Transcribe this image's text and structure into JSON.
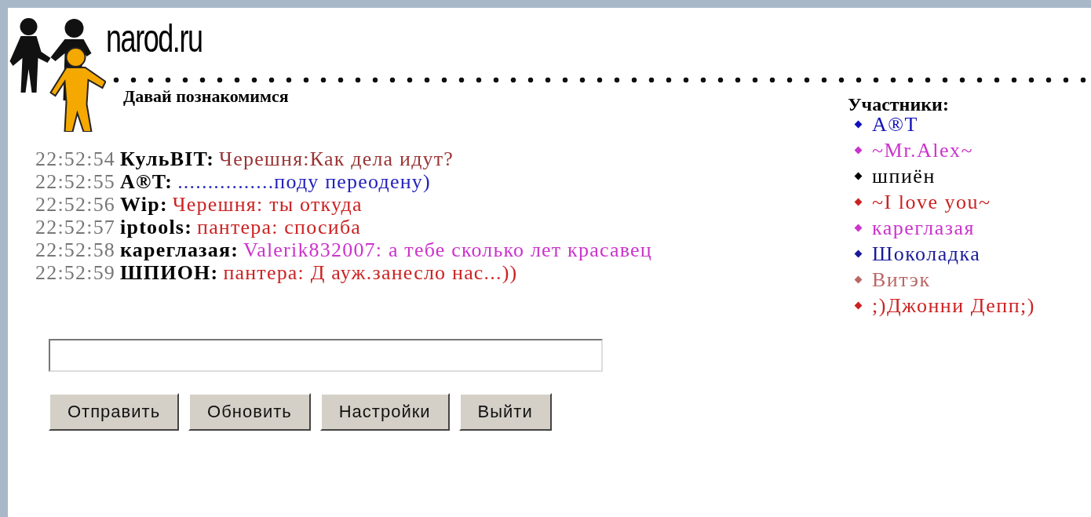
{
  "brand": "narod.ru",
  "room_title": "Давай познакомимся",
  "messages": [
    {
      "time": "22:52:54",
      "author": "КульBIT:",
      "text": "Черешня:Как дела идут?",
      "color": "#993333"
    },
    {
      "time": "22:52:55",
      "author": "A®T:",
      "text": "................поду переодену)",
      "color": "#2222bb"
    },
    {
      "time": "22:52:56",
      "author": "Wip:",
      "text": "Черешня: ты откуда",
      "color": "#cc2222"
    },
    {
      "time": "22:52:57",
      "author": "iptools:",
      "text": "пантера: спосиба",
      "color": "#cc2222"
    },
    {
      "time": "22:52:58",
      "author": "кареглазая:",
      "text": "Valerik832007: а тебе сколько лет красавец",
      "color": "#cc33cc"
    },
    {
      "time": "22:52:59",
      "author": "ШПИОН:",
      "text": "пантера: Д ауж.занесло нас...))",
      "color": "#cc2222"
    }
  ],
  "participants": {
    "title": "Участники:",
    "items": [
      {
        "name": "A®T",
        "color": "#1111bb"
      },
      {
        "name": "~Mr.Alex~",
        "color": "#cc33cc"
      },
      {
        "name": "шпиён",
        "color": "#000000"
      },
      {
        "name": "~I love you~",
        "color": "#cc2222"
      },
      {
        "name": "кареглазая",
        "color": "#cc33cc"
      },
      {
        "name": "Шоколадка",
        "color": "#1a1a99"
      },
      {
        "name": "Витэк",
        "color": "#bb6666"
      },
      {
        "name": ";)Джонни Депп;)",
        "color": "#cc2222"
      }
    ]
  },
  "buttons": [
    "Отправить",
    "Обновить",
    "Настройки",
    "Выйти"
  ]
}
